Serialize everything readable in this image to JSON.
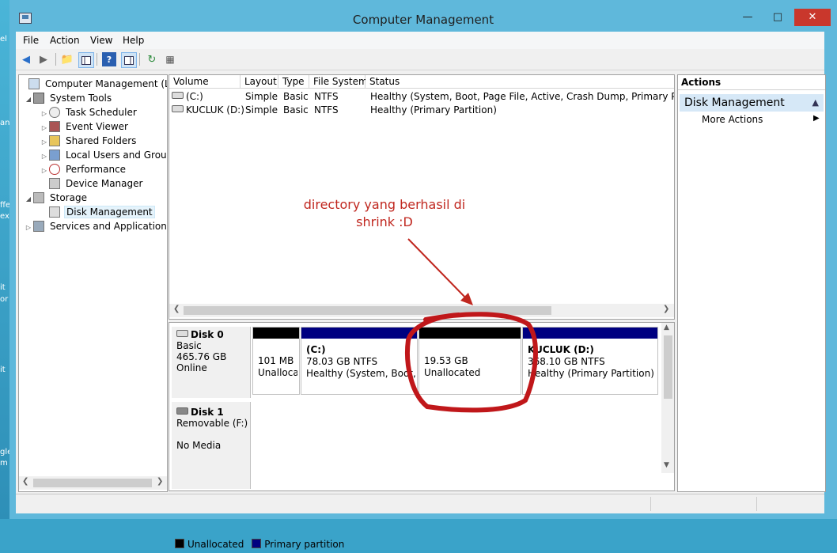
{
  "window": {
    "title": "Computer Management"
  },
  "menu": {
    "file": "File",
    "action": "Action",
    "view": "View",
    "help": "Help"
  },
  "toolbar": {
    "icons": [
      "back-icon",
      "forward-icon",
      "up-folder-icon",
      "show-hide-tree-icon",
      "help-icon",
      "show-hide-action-icon",
      "refresh-icon",
      "properties-icon"
    ]
  },
  "tree": {
    "root": "Computer Management (Local",
    "system_tools": "System Tools",
    "task_scheduler": "Task Scheduler",
    "event_viewer": "Event Viewer",
    "shared_folders": "Shared Folders",
    "local_users": "Local Users and Groups",
    "performance": "Performance",
    "device_manager": "Device Manager",
    "storage": "Storage",
    "disk_management": "Disk Management",
    "services_apps": "Services and Applications"
  },
  "volumes": {
    "columns": [
      "Volume",
      "Layout",
      "Type",
      "File System",
      "Status"
    ],
    "rows": [
      {
        "volume": "(C:)",
        "layout": "Simple",
        "type": "Basic",
        "fs": "NTFS",
        "status": "Healthy (System, Boot, Page File, Active, Crash Dump, Primary Partition)"
      },
      {
        "volume": "KUCLUK (D:)",
        "layout": "Simple",
        "type": "Basic",
        "fs": "NTFS",
        "status": "Healthy (Primary Partition)"
      }
    ]
  },
  "disks": {
    "disk0": {
      "name": "Disk 0",
      "type": "Basic",
      "size": "465.76 GB",
      "state": "Online"
    },
    "disk1": {
      "name": "Disk 1",
      "type": "Removable (F:)",
      "state": "No Media"
    },
    "partitions": [
      {
        "line1": "",
        "line2": "101 MB",
        "line3": "Unalloca",
        "color": "#000000"
      },
      {
        "line1": "(C:)",
        "line2": "78.03 GB NTFS",
        "line3": "Healthy (System, Boot, P",
        "color": "#000080"
      },
      {
        "line1": "",
        "line2": "19.53 GB",
        "line3": "Unallocated",
        "color": "#000000"
      },
      {
        "line1": "KUCLUK  (D:)",
        "line2": "368.10 GB NTFS",
        "line3": "Healthy (Primary Partition)",
        "color": "#000080"
      }
    ]
  },
  "legend": {
    "unallocated": "Unallocated",
    "primary": "Primary partition",
    "unallocated_color": "#000000",
    "primary_color": "#000080"
  },
  "actions": {
    "header": "Actions",
    "section": "Disk Management",
    "more": "More Actions"
  },
  "annotation": {
    "line1": "directory yang berhasil di",
    "line2": "shrink :D",
    "color": "#c0271f"
  },
  "desktop_fragments": [
    "el",
    "an",
    "ffe",
    "ex",
    "it",
    "or",
    "it",
    "gle",
    "m"
  ]
}
